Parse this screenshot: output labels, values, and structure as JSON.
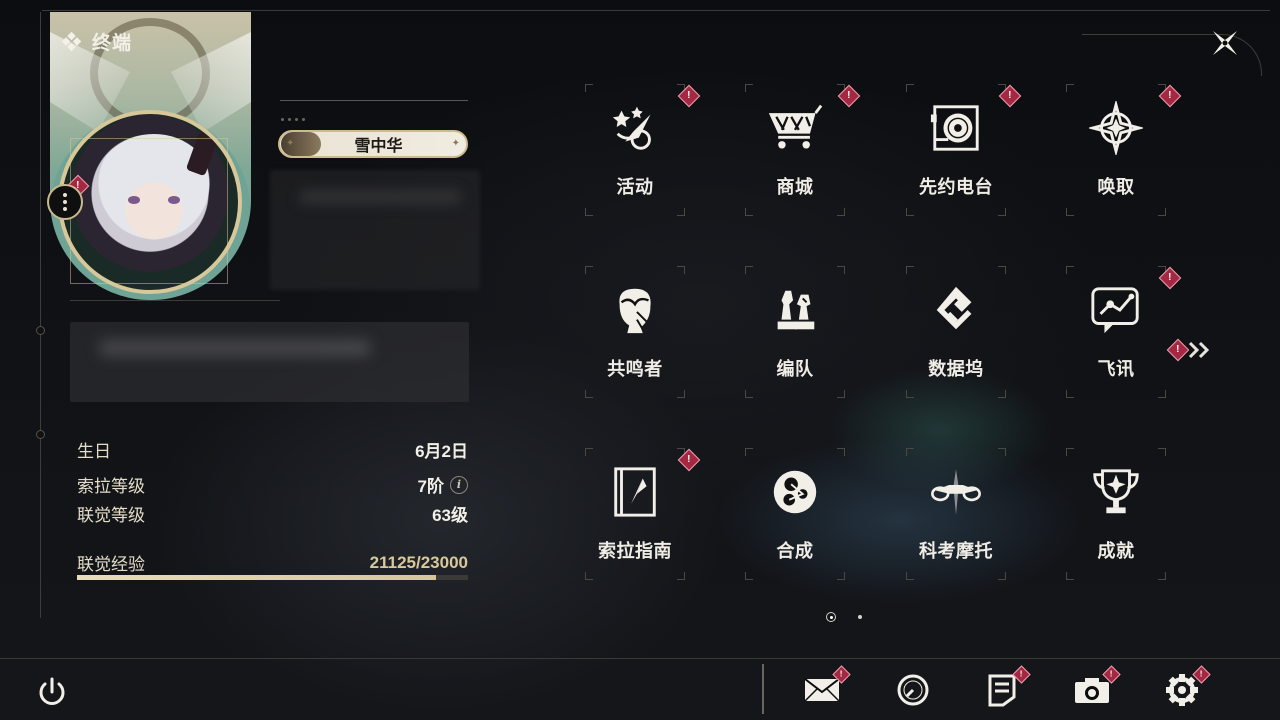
{
  "window": {
    "title": "终端"
  },
  "profile": {
    "name": "雪中华",
    "stats": {
      "birthday_label": "生日",
      "birthday_value": "6月2日",
      "sola_level_label": "索拉等级",
      "sola_level_value": "7阶",
      "union_level_label": "联觉等级",
      "union_level_value": "63级",
      "union_xp_label": "联觉经验",
      "union_xp_value": "21125/23000",
      "union_xp_progress": 0.918
    }
  },
  "grid": {
    "tiles": [
      {
        "label": "活动",
        "icon": "activity-stars-icon",
        "alert": true
      },
      {
        "label": "商城",
        "icon": "shopping-cart-icon",
        "alert": true
      },
      {
        "label": "先约电台",
        "icon": "radio-record-icon",
        "alert": true
      },
      {
        "label": "唤取",
        "icon": "convene-star-icon",
        "alert": true
      },
      {
        "label": "共鸣者",
        "icon": "resonator-head-icon",
        "alert": false
      },
      {
        "label": "编队",
        "icon": "team-chess-icon",
        "alert": false
      },
      {
        "label": "数据坞",
        "icon": "data-bank-icon",
        "alert": false
      },
      {
        "label": "飞讯",
        "icon": "message-chat-icon",
        "alert": true
      },
      {
        "label": "索拉指南",
        "icon": "guide-book-icon",
        "alert": true
      },
      {
        "label": "合成",
        "icon": "synthesis-icon",
        "alert": false
      },
      {
        "label": "科考摩托",
        "icon": "motorbike-icon",
        "alert": false
      },
      {
        "label": "成就",
        "icon": "trophy-icon",
        "alert": false
      }
    ],
    "pagination": {
      "current": 1,
      "total": 2
    }
  },
  "alert_mark": "!",
  "info_mark": "i",
  "colors": {
    "accent_gold": "#d6c59a",
    "alert_red": "#a52843",
    "text_light": "#f0ede6"
  },
  "bottom_bar": {
    "icons": [
      "power-icon",
      "mail-icon",
      "clock-icon",
      "notes-icon",
      "camera-icon",
      "settings-gear-icon"
    ]
  }
}
